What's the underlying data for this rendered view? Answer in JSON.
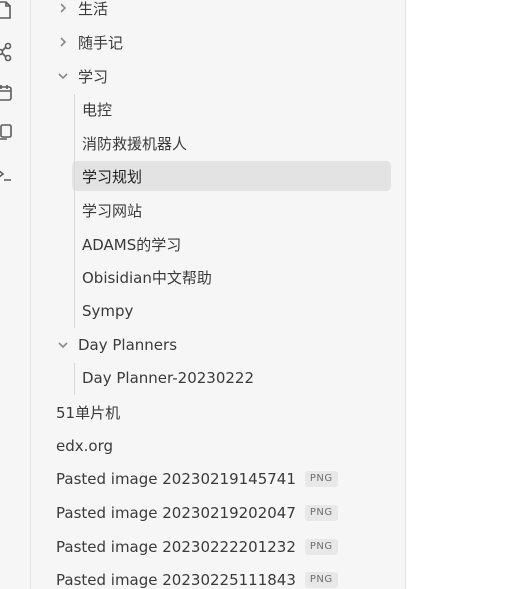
{
  "ribbon": {
    "icons": [
      "file-icon",
      "graph-icon",
      "calendar-icon",
      "copy-icon",
      "command-icon"
    ]
  },
  "tree": {
    "folders": [
      {
        "label": "生活",
        "expanded": false
      },
      {
        "label": "随手记",
        "expanded": false
      },
      {
        "label": "学习",
        "expanded": true,
        "children": [
          "电控",
          "消防救援机器人",
          "学习规划",
          "学习网站",
          "ADAMS的学习",
          "Obisidian中文帮助",
          "Sympy"
        ]
      },
      {
        "label": "Day Planners",
        "expanded": true,
        "children": [
          "Day Planner-20230222"
        ]
      }
    ],
    "active_item": "学习规划",
    "files": [
      "51单片机",
      "edx.org"
    ],
    "images": [
      {
        "name": "Pasted image 20230219145741",
        "badge": "PNG"
      },
      {
        "name": "Pasted image 20230219202047",
        "badge": "PNG"
      },
      {
        "name": "Pasted image 20230222201232",
        "badge": "PNG"
      },
      {
        "name": "Pasted image 20230225111843",
        "badge": "PNG"
      }
    ]
  },
  "colors": {
    "sidebar_bg": "#f6f6f6",
    "active_bg": "#e3e3e3",
    "text": "#3a3a3a",
    "muted": "#8a8a8a"
  }
}
